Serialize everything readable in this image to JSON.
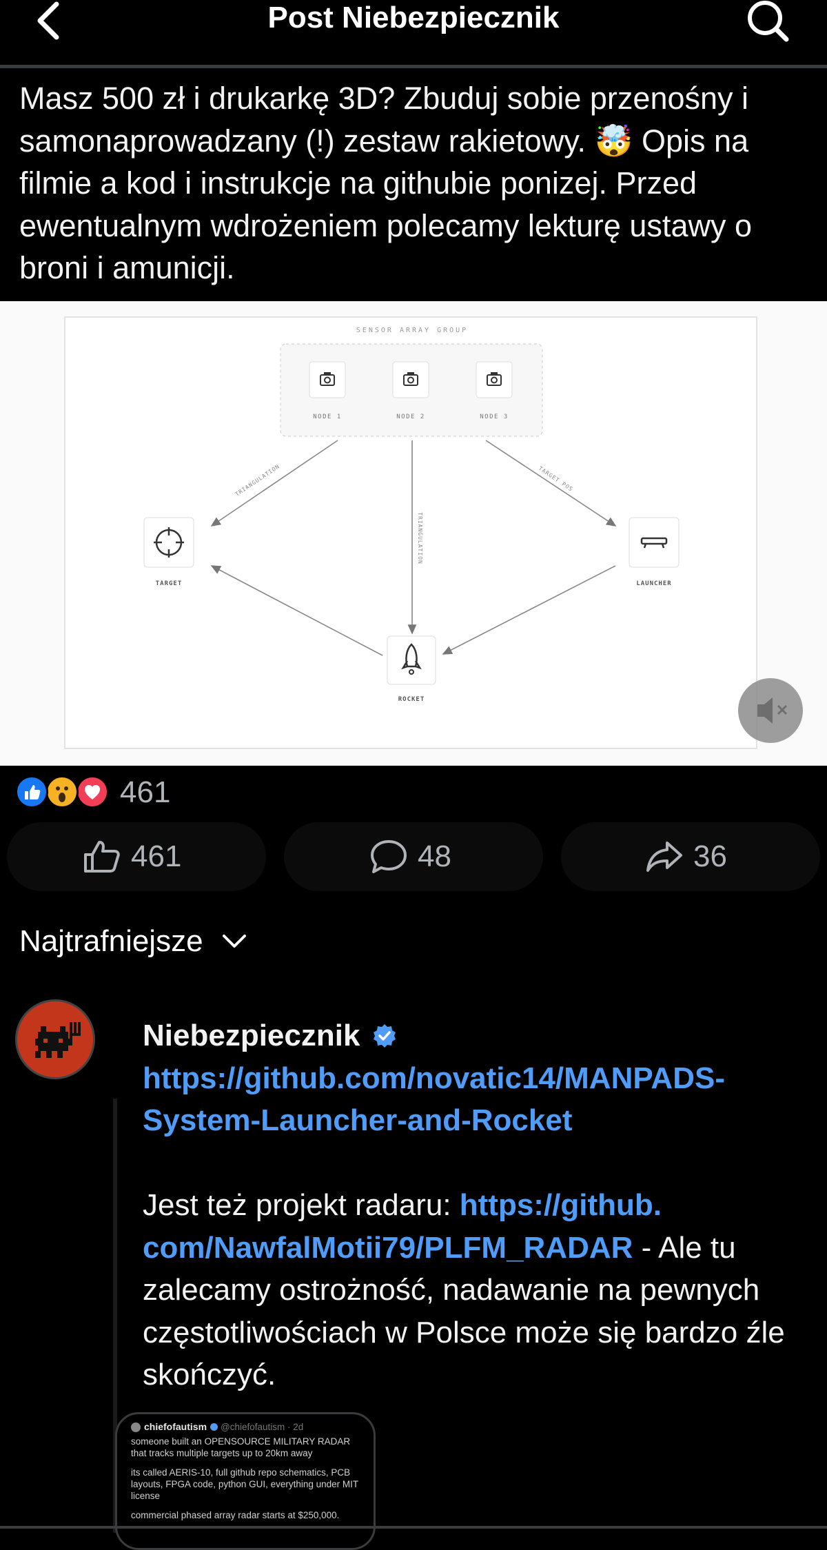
{
  "header": {
    "title": "Post Niebezpiecznik",
    "back_icon": "chevron-left-icon",
    "search_icon": "search-icon"
  },
  "post": {
    "text": "Masz 500 zł i drukarkę 3D? Zbuduj sobie przenośny i samonaprowadzany (!) zestaw rakietowy. 🤯 Opis na filmie a kod i instrukcje na githubie ponizej. Przed ewentualnym wdrożeniem polecamy lekturę ustawy o broni i amunicji."
  },
  "diagram": {
    "group_label": "SENSOR ARRAY GROUP",
    "nodes": [
      "NODE 1",
      "NODE 2",
      "NODE 3"
    ],
    "target": "TARGET",
    "launcher": "LAUNCHER",
    "rocket": "ROCKET",
    "edge_left": "TRIANGULATION",
    "edge_middle": "TRIANGULATION",
    "edge_right": "TARGET POS"
  },
  "reactions": {
    "icons": [
      "like-reaction-icon",
      "wow-reaction-icon",
      "love-reaction-icon"
    ],
    "count": "461"
  },
  "actions": {
    "like_count": "461",
    "comment_count": "48",
    "share_count": "36"
  },
  "sort": {
    "label": "Najtrafniejsze"
  },
  "comment": {
    "author": "Niebezpiecznik",
    "link1": "https://github.com/novatic14/MANPADS-System-Launcher-and-Rocket",
    "link1_line1": "https://github.com/novatic14/MANPADS-",
    "link1_line2": "System-Launcher-and-Rocket",
    "text_before": "Jest też projekt radaru: ",
    "link2_line1": "https://github.",
    "link2_line2": "com/NawfalMotii79/PLFM_RADAR",
    "text_after": " - Ale tu zalecamy ostrożność, nadawanie na pewnych częstotliwościach w Polsce może się bardzo źle skończyć."
  },
  "embed": {
    "author": "chiefofautism",
    "handle_time": "@chiefofautism · 2d",
    "line1": "someone built an OPENSOURCE MILITARY RADAR that tracks multiple targets up to 20km away",
    "line2": "its called AERIS-10, full github repo schematics, PCB layouts, FPGA code, python GUI, everything under MIT license",
    "line3": "commercial phased array radar starts at $250,000."
  },
  "colors": {
    "background": "#000000",
    "link": "#4f9cf9",
    "muted": "#b0b3b8",
    "avatar": "#c4361c",
    "like_blue": "#1877f2",
    "love_red": "#f33e58",
    "wow_yellow": "#f7b125"
  }
}
